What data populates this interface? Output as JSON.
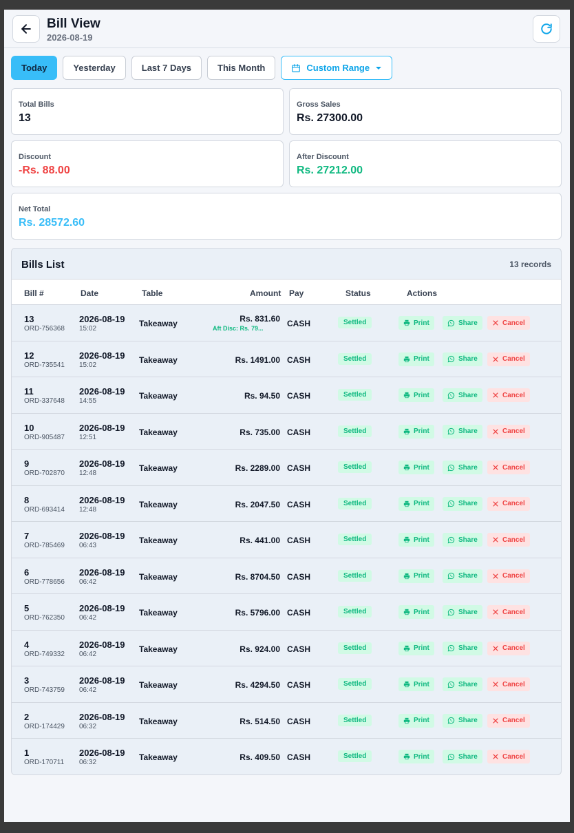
{
  "header": {
    "title": "Bill View",
    "date": "2026-08-19"
  },
  "filters": [
    {
      "label": "Today",
      "active": true
    },
    {
      "label": "Yesterday",
      "active": false
    },
    {
      "label": "Last 7 Days",
      "active": false
    },
    {
      "label": "This Month",
      "active": false
    },
    {
      "label": "Custom Range",
      "active": false
    }
  ],
  "summary": {
    "total_bills": {
      "label": "Total Bills",
      "value": "13"
    },
    "gross_sales": {
      "label": "Gross Sales",
      "value": "Rs. 27300.00"
    },
    "discount": {
      "label": "Discount",
      "value": "-Rs. 88.00"
    },
    "after_discount": {
      "label": "After Discount",
      "value": "Rs. 27212.00"
    },
    "net_total": {
      "label": "Net Total",
      "value": "Rs. 28572.60"
    }
  },
  "list": {
    "title": "Bills List",
    "count": "13 records",
    "columns": [
      "Bill #",
      "Date",
      "Table",
      "Amount",
      "Pay",
      "Status",
      "Actions"
    ],
    "actions": {
      "print": "Print",
      "share": "Share",
      "cancel": "Cancel"
    },
    "rows": [
      {
        "no": "13",
        "order": "ORD-756368",
        "date": "2026-08-19",
        "time": "15:02",
        "table": "Takeaway",
        "amount": "Rs. 831.60",
        "disc": "Aft Disc: Rs. 79...",
        "pay": "CASH",
        "status": "Settled"
      },
      {
        "no": "12",
        "order": "ORD-735541",
        "date": "2026-08-19",
        "time": "15:02",
        "table": "Takeaway",
        "amount": "Rs. 1491.00",
        "disc": "",
        "pay": "CASH",
        "status": "Settled"
      },
      {
        "no": "11",
        "order": "ORD-337648",
        "date": "2026-08-19",
        "time": "14:55",
        "table": "Takeaway",
        "amount": "Rs. 94.50",
        "disc": "",
        "pay": "CASH",
        "status": "Settled"
      },
      {
        "no": "10",
        "order": "ORD-905487",
        "date": "2026-08-19",
        "time": "12:51",
        "table": "Takeaway",
        "amount": "Rs. 735.00",
        "disc": "",
        "pay": "CASH",
        "status": "Settled"
      },
      {
        "no": "9",
        "order": "ORD-702870",
        "date": "2026-08-19",
        "time": "12:48",
        "table": "Takeaway",
        "amount": "Rs. 2289.00",
        "disc": "",
        "pay": "CASH",
        "status": "Settled"
      },
      {
        "no": "8",
        "order": "ORD-693414",
        "date": "2026-08-19",
        "time": "12:48",
        "table": "Takeaway",
        "amount": "Rs. 2047.50",
        "disc": "",
        "pay": "CASH",
        "status": "Settled"
      },
      {
        "no": "7",
        "order": "ORD-785469",
        "date": "2026-08-19",
        "time": "06:43",
        "table": "Takeaway",
        "amount": "Rs. 441.00",
        "disc": "",
        "pay": "CASH",
        "status": "Settled"
      },
      {
        "no": "6",
        "order": "ORD-778656",
        "date": "2026-08-19",
        "time": "06:42",
        "table": "Takeaway",
        "amount": "Rs. 8704.50",
        "disc": "",
        "pay": "CASH",
        "status": "Settled"
      },
      {
        "no": "5",
        "order": "ORD-762350",
        "date": "2026-08-19",
        "time": "06:42",
        "table": "Takeaway",
        "amount": "Rs. 5796.00",
        "disc": "",
        "pay": "CASH",
        "status": "Settled"
      },
      {
        "no": "4",
        "order": "ORD-749332",
        "date": "2026-08-19",
        "time": "06:42",
        "table": "Takeaway",
        "amount": "Rs. 924.00",
        "disc": "",
        "pay": "CASH",
        "status": "Settled"
      },
      {
        "no": "3",
        "order": "ORD-743759",
        "date": "2026-08-19",
        "time": "06:42",
        "table": "Takeaway",
        "amount": "Rs. 4294.50",
        "disc": "",
        "pay": "CASH",
        "status": "Settled"
      },
      {
        "no": "2",
        "order": "ORD-174429",
        "date": "2026-08-19",
        "time": "06:32",
        "table": "Takeaway",
        "amount": "Rs. 514.50",
        "disc": "",
        "pay": "CASH",
        "status": "Settled"
      },
      {
        "no": "1",
        "order": "ORD-170711",
        "date": "2026-08-19",
        "time": "06:32",
        "table": "Takeaway",
        "amount": "Rs. 409.50",
        "disc": "",
        "pay": "CASH",
        "status": "Settled"
      }
    ]
  },
  "colors": {
    "accent": "#38bdf8",
    "success": "#10b981",
    "danger": "#ef4444"
  }
}
